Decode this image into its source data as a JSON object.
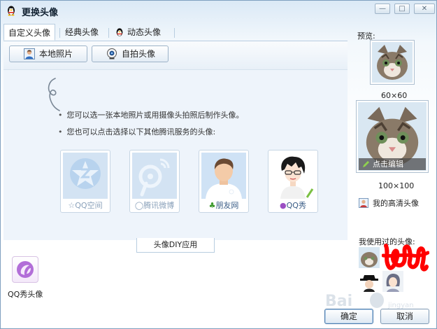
{
  "window": {
    "title": "更换头像"
  },
  "tabs": [
    {
      "label": "自定义头像",
      "active": true
    },
    {
      "label": "经典头像",
      "active": false
    },
    {
      "label": "动态头像",
      "active": false,
      "icon": "penguin-icon"
    }
  ],
  "toolbar": {
    "local_photo_label": "本地照片",
    "selfie_label": "自拍头像"
  },
  "tips": [
    "您可以选一张本地照片或用摄像头拍照后制作头像。",
    "您也可以点击选择以下其他腾讯服务的头像:"
  ],
  "services": [
    {
      "label": "QQ空间",
      "icon": "qzone-icon",
      "enabled": false
    },
    {
      "label": "腾讯微博",
      "icon": "weibo-icon",
      "enabled": false
    },
    {
      "label": "朋友网",
      "icon": "pengyou-icon",
      "enabled": true
    },
    {
      "label": "QQ秀",
      "icon": "qqshow-icon",
      "enabled": true
    }
  ],
  "diy": {
    "tab_label": "头像DIY应用",
    "apps": [
      {
        "label": "QQ秀头像",
        "icon": "qqshow-app-icon"
      }
    ]
  },
  "preview": {
    "label": "预览:",
    "small_size": "60×60",
    "large_size": "100×100",
    "edit_label": "点击编辑",
    "hd_label": "我的高清头像",
    "used_label": "我使用过的头像:"
  },
  "buttons": {
    "ok": "确定",
    "cancel": "取消"
  },
  "watermark": {
    "text": "Bai",
    "sub": "jingyan"
  },
  "colors": {
    "accent": "#3a5d86",
    "scribble": "#ff0000",
    "border": "#7fa0bf"
  }
}
